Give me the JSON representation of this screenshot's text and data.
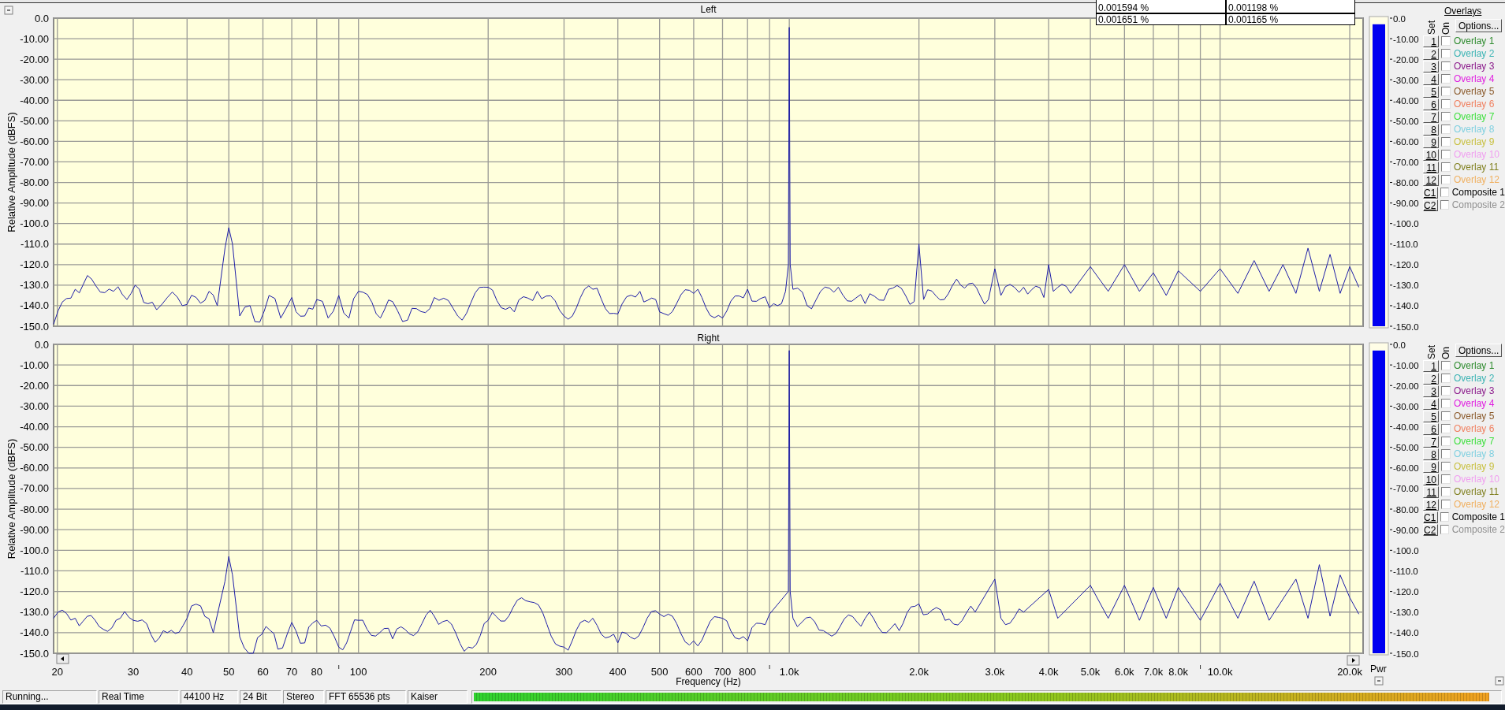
{
  "readouts": [
    {
      "cells": [
        "0.001594 %",
        "0.001198 %"
      ]
    },
    {
      "cells": [
        "0.001651 %",
        "0.001165 %"
      ]
    }
  ],
  "overlays_title": "Overlays",
  "channels": [
    {
      "plot": {
        "title": "Left",
        "ylabel": "Relative Amplitude (dBFS)",
        "yticks": [
          "0.0",
          "-10.00",
          "-20.00",
          "-30.00",
          "-40.00",
          "-50.00",
          "-60.00",
          "-70.00",
          "-80.00",
          "-90.00",
          "-100.0",
          "-110.0",
          "-120.0",
          "-130.0",
          "-140.0",
          "-150.0"
        ]
      },
      "overlay_panel": {
        "meter": {
          "level": 0.98,
          "ticks": [
            "0.0",
            "-10.00",
            "-20.00",
            "-30.00",
            "-40.00",
            "-50.00",
            "-60.00",
            "-70.00",
            "-80.00",
            "-90.00",
            "-100.0",
            "-110.0",
            "-120.0",
            "-130.0",
            "-140.0",
            "-150.0"
          ]
        },
        "set_label": "Set",
        "on_label": "On",
        "options_button": "Options...",
        "rows": [
          {
            "set": "1",
            "label": "Overlay 1",
            "color": "#2e8b2e",
            "checked": false
          },
          {
            "set": "2",
            "label": "Overlay 2",
            "color": "#3cb4b4",
            "checked": false
          },
          {
            "set": "3",
            "label": "Overlay 3",
            "color": "#8b1a8b",
            "checked": false
          },
          {
            "set": "4",
            "label": "Overlay 4",
            "color": "#e020e0",
            "checked": false
          },
          {
            "set": "5",
            "label": "Overlay 5",
            "color": "#8b5a2b",
            "checked": false
          },
          {
            "set": "6",
            "label": "Overlay 6",
            "color": "#f08060",
            "checked": false
          },
          {
            "set": "7",
            "label": "Overlay 7",
            "color": "#40e040",
            "checked": false
          },
          {
            "set": "8",
            "label": "Overlay 8",
            "color": "#80d0e0",
            "checked": false
          },
          {
            "set": "9",
            "label": "Overlay 9",
            "color": "#c8c040",
            "checked": false
          },
          {
            "set": "10",
            "label": "Overlay 10",
            "color": "#f0a0f0",
            "checked": false
          },
          {
            "set": "11",
            "label": "Overlay 11",
            "color": "#808020",
            "checked": false
          },
          {
            "set": "12",
            "label": "Overlay 12",
            "color": "#f0b060",
            "checked": false
          },
          {
            "set": "C1",
            "label": "Composite 1",
            "color": "#000000",
            "checked": false
          },
          {
            "set": "C2",
            "label": "Composite 2",
            "color": "#909090",
            "checked": false
          }
        ]
      }
    },
    {
      "plot": {
        "title": "Right",
        "ylabel": "Relative Amplitude (dBFS)",
        "xlabel": "Frequency (Hz)",
        "yticks": [
          "0.0",
          "-10.00",
          "-20.00",
          "-30.00",
          "-40.00",
          "-50.00",
          "-60.00",
          "-70.00",
          "-80.00",
          "-90.00",
          "-100.0",
          "-110.0",
          "-120.0",
          "-130.0",
          "-140.0",
          "-150.0"
        ],
        "xticks": [
          "20",
          "30",
          "40",
          "50",
          "60",
          "70",
          "80",
          "100",
          "200",
          "300",
          "400",
          "500",
          "600",
          "700",
          "800",
          "1.0k",
          "2.0k",
          "3.0k",
          "4.0k",
          "5.0k",
          "6.0k",
          "7.0k",
          "8.0k",
          "10.0k",
          "20.0k"
        ]
      },
      "overlay_panel": {
        "meter": {
          "level": 0.98,
          "ticks": [
            "0.0",
            "-10.00",
            "-20.00",
            "-30.00",
            "-40.00",
            "-50.00",
            "-60.00",
            "-70.00",
            "-80.00",
            "-90.00",
            "-100.0",
            "-110.0",
            "-120.0",
            "-130.0",
            "-140.0",
            "-150.0"
          ],
          "label": "Pwr"
        },
        "set_label": "Set",
        "on_label": "On",
        "options_button": "Options...",
        "rows": [
          {
            "set": "1",
            "label": "Overlay 1",
            "color": "#2e8b2e",
            "checked": false
          },
          {
            "set": "2",
            "label": "Overlay 2",
            "color": "#3cb4b4",
            "checked": false
          },
          {
            "set": "3",
            "label": "Overlay 3",
            "color": "#8b1a8b",
            "checked": false
          },
          {
            "set": "4",
            "label": "Overlay 4",
            "color": "#e020e0",
            "checked": false
          },
          {
            "set": "5",
            "label": "Overlay 5",
            "color": "#8b5a2b",
            "checked": false
          },
          {
            "set": "6",
            "label": "Overlay 6",
            "color": "#f08060",
            "checked": false
          },
          {
            "set": "7",
            "label": "Overlay 7",
            "color": "#40e040",
            "checked": false
          },
          {
            "set": "8",
            "label": "Overlay 8",
            "color": "#80d0e0",
            "checked": false
          },
          {
            "set": "9",
            "label": "Overlay 9",
            "color": "#c8c040",
            "checked": false
          },
          {
            "set": "10",
            "label": "Overlay 10",
            "color": "#f0a0f0",
            "checked": false
          },
          {
            "set": "11",
            "label": "Overlay 11",
            "color": "#808020",
            "checked": false
          },
          {
            "set": "12",
            "label": "Overlay 12",
            "color": "#f0b060",
            "checked": false
          },
          {
            "set": "C1",
            "label": "Composite 1",
            "color": "#000000",
            "checked": false
          },
          {
            "set": "C2",
            "label": "Composite 2",
            "color": "#909090",
            "checked": false
          }
        ]
      }
    }
  ],
  "status_bar": {
    "fields": [
      "Running...",
      "Real Time",
      "44100 Hz",
      "24 Bit",
      "Stereo",
      "FFT 65536 pts",
      "Kaiser"
    ],
    "meter": {
      "level": 0.99
    }
  }
}
